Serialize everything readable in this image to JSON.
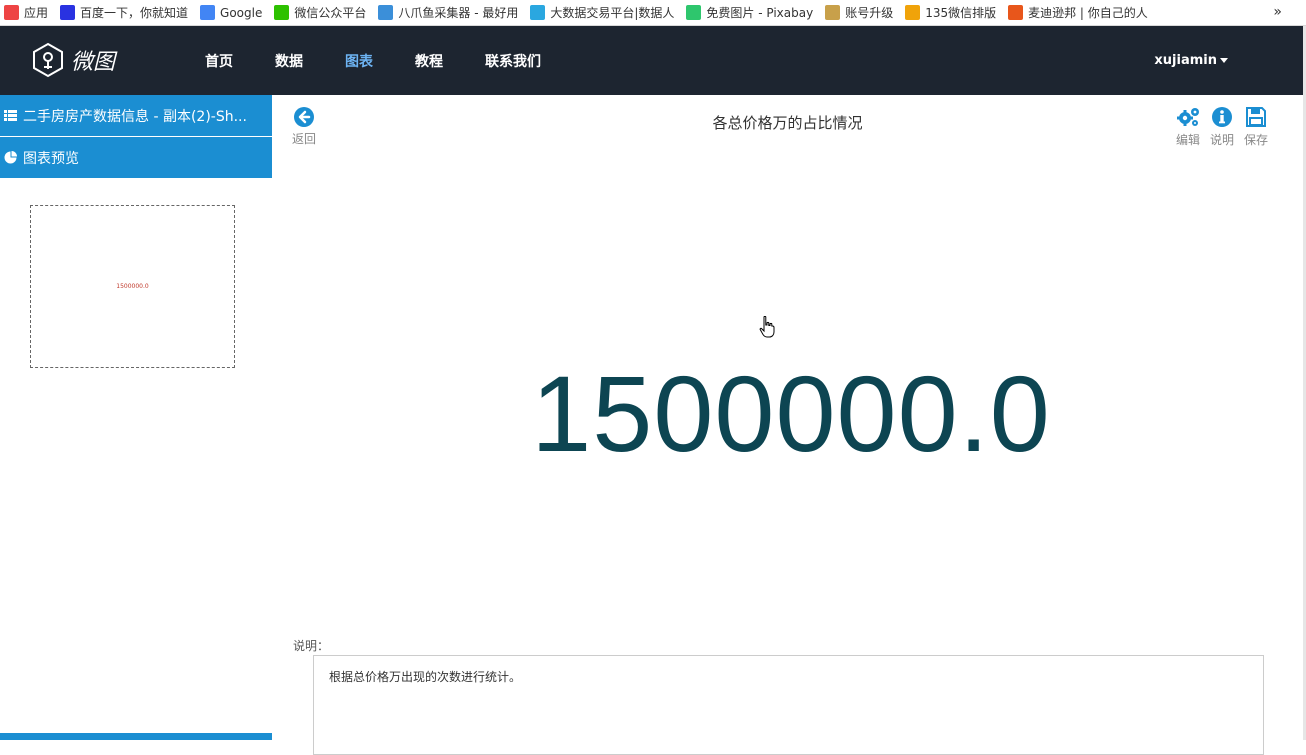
{
  "bookmarks": [
    {
      "label": "应用",
      "icon": "apps-grid-icon",
      "color": "#e44"
    },
    {
      "label": "百度一下，你就知道",
      "icon": "baidu-paw-icon",
      "color": "#2932e1"
    },
    {
      "label": "Google",
      "icon": "google-g-icon",
      "color": "#4285f4"
    },
    {
      "label": "微信公众平台",
      "icon": "wechat-icon",
      "color": "#2dc100"
    },
    {
      "label": "八爪鱼采集器 - 最好用",
      "icon": "octopus-icon",
      "color": "#3b8fd9"
    },
    {
      "label": "大数据交易平台|数据人",
      "icon": "data-platform-icon",
      "color": "#2aa7e0"
    },
    {
      "label": "免费图片 - Pixabay",
      "icon": "pixabay-icon",
      "color": "#2ec66d"
    },
    {
      "label": "账号升级",
      "icon": "account-upgrade-icon",
      "color": "#c8a04a"
    },
    {
      "label": "135微信排版",
      "icon": "editor-135-icon",
      "color": "#f0a30a"
    },
    {
      "label": "麦迪逊邦 | 你自己的人",
      "icon": "madisonboom-icon",
      "color": "#e8561b"
    }
  ],
  "bookmarks_more": "»",
  "brand": {
    "name": "微图"
  },
  "nav": {
    "items": [
      {
        "label": "首页"
      },
      {
        "label": "数据"
      },
      {
        "label": "图表",
        "active": true
      },
      {
        "label": "教程"
      },
      {
        "label": "联系我们"
      }
    ],
    "active_color": "#6db3f2",
    "bg_color": "#1d2530"
  },
  "user": {
    "name": "xujiamin"
  },
  "sidebar": {
    "dataset": "二手房房产数据信息 - 副本(2)-Sh...",
    "preview_title": "图表预览",
    "preview_value": "1500000.0",
    "accent_color": "#1b8ed2"
  },
  "main": {
    "back_label": "返回",
    "chart_title": "各总价格万的占比情况",
    "tools": [
      {
        "label": "编辑",
        "icon": "gears-icon"
      },
      {
        "label": "说明",
        "icon": "info-icon"
      },
      {
        "label": "保存",
        "icon": "save-icon"
      }
    ],
    "value": "1500000.0",
    "value_color": "#0d4552",
    "desc_label": "说明：",
    "desc_text": "根据总价格万出现的次数进行统计。"
  }
}
